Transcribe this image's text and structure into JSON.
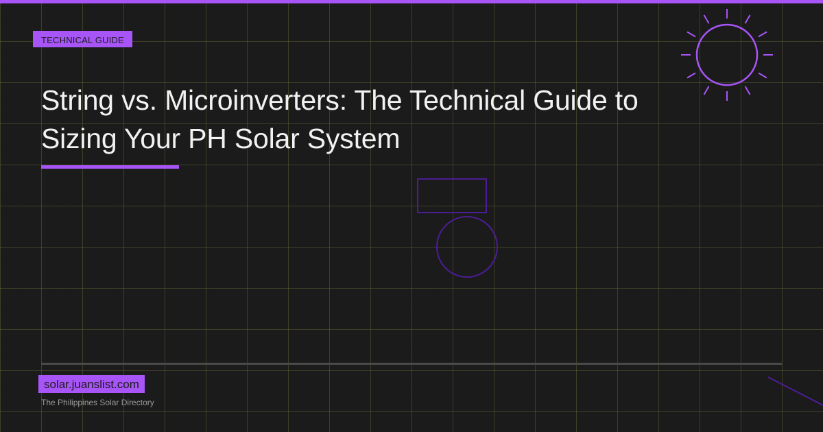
{
  "category": "TECHNICAL GUIDE",
  "title": {
    "line1": "String vs. Microinverters: The Technical Guide to",
    "line2": "Sizing Your PH Solar System"
  },
  "footer": {
    "site": "solar.juanslist.com",
    "tagline": "The Philippines Solar Directory"
  },
  "icons": {
    "sun": "sun-icon",
    "panel": "solar-panel-outline",
    "circle": "circle-outline"
  },
  "colors": {
    "accent": "#a855f7",
    "dark_accent": "#4c1d95",
    "background": "#1b1b1b",
    "grid": "#4a4a2a",
    "text": "#f2f2f2",
    "muted_text": "#9a9a9a"
  }
}
